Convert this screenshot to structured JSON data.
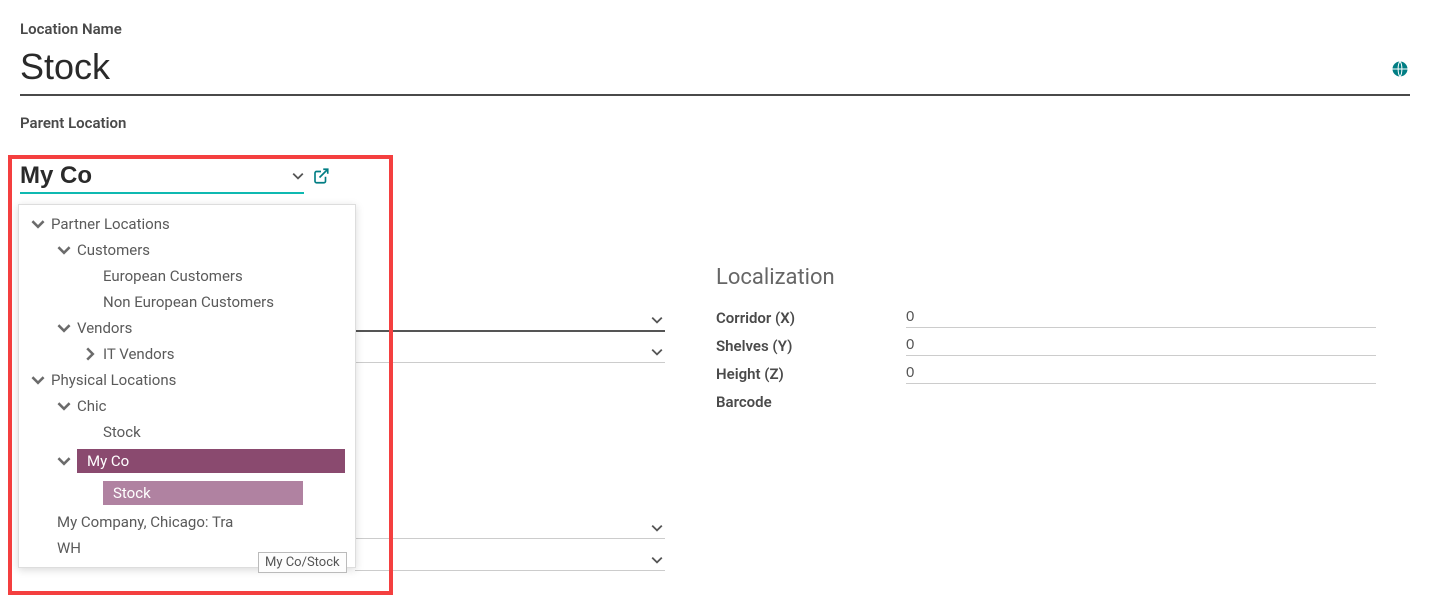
{
  "labels": {
    "location_name": "Location Name",
    "parent_location": "Parent Location",
    "localization": "Localization",
    "corridor": "Corridor (X)",
    "shelves": "Shelves (Y)",
    "height": "Height (Z)",
    "barcode": "Barcode"
  },
  "values": {
    "location_name": "Stock",
    "parent_input": "My Co",
    "corridor": "0",
    "shelves": "0",
    "height": "0",
    "barcode": ""
  },
  "dropdown": {
    "items": [
      {
        "label": "Partner Locations",
        "level": 0,
        "icon": "down"
      },
      {
        "label": "Customers",
        "level": 1,
        "icon": "down"
      },
      {
        "label": "European Customers",
        "level": 2,
        "icon": "none"
      },
      {
        "label": "Non European Customers",
        "level": 2,
        "icon": "none"
      },
      {
        "label": "Vendors",
        "level": 1,
        "icon": "down"
      },
      {
        "label": "IT Vendors",
        "level": 2,
        "icon": "right"
      },
      {
        "label": "Physical Locations",
        "level": 0,
        "icon": "down"
      },
      {
        "label": "Chic",
        "level": 1,
        "icon": "down"
      },
      {
        "label": "Stock",
        "level": 2,
        "icon": "none"
      },
      {
        "label": "My Co",
        "level": 1,
        "icon": "down",
        "selected": "parent"
      },
      {
        "label": "Stock",
        "level": 2,
        "icon": "none",
        "selected": "child"
      },
      {
        "label": "My Company, Chicago: Tra",
        "level": 1,
        "icon": "none"
      },
      {
        "label": "WH",
        "level": 1,
        "icon": "none"
      }
    ]
  },
  "tooltip": "My Co/Stock"
}
